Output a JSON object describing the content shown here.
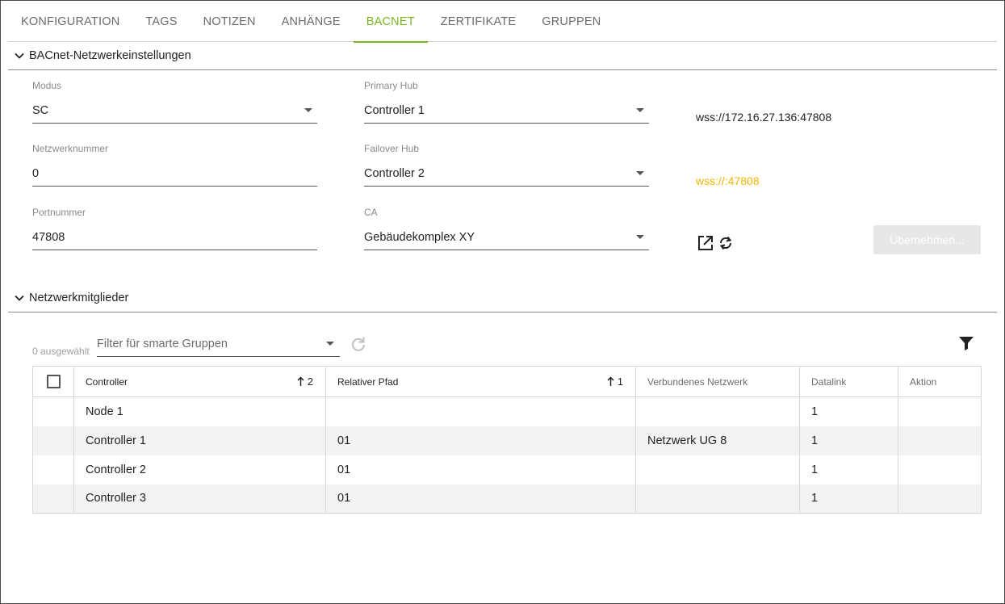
{
  "tabs": [
    {
      "label": "KONFIGURATION"
    },
    {
      "label": "TAGS"
    },
    {
      "label": "NOTIZEN"
    },
    {
      "label": "ANHÄNGE"
    },
    {
      "label": "BACNET",
      "active": true
    },
    {
      "label": "ZERTIFIKATE"
    },
    {
      "label": "GRUPPEN"
    }
  ],
  "network_settings": {
    "title": "BACnet-Netzwerkeinstellungen",
    "modus": {
      "label": "Modus",
      "value": "SC"
    },
    "netzwerknummer": {
      "label": "Netzwerknummer",
      "value": "0"
    },
    "portnummer": {
      "label": "Portnummer",
      "value": "47808"
    },
    "primary_hub": {
      "label": "Primary Hub",
      "value": "Controller 1"
    },
    "failover_hub": {
      "label": "Failover Hub",
      "value": "Controller 2"
    },
    "ca": {
      "label": "CA",
      "value": "Gebäudekomplex XY"
    },
    "primary_url": "wss://172.16.27.136:47808",
    "failover_url": "wss://:47808",
    "apply_label": "Übernehmen..."
  },
  "members": {
    "title": "Netzwerkmitglieder",
    "selected_count": "0 ausgewählt",
    "filter_placeholder": "Filter für smarte Gruppen",
    "columns": {
      "controller": "Controller",
      "controller_sort": "2",
      "path": "Relativer Pfad",
      "path_sort": "1",
      "network": "Verbundenes Netzwerk",
      "datalink": "Datalink",
      "action": "Aktion"
    },
    "rows": [
      {
        "controller": "Node 1",
        "path": "",
        "network": "",
        "datalink": "1",
        "action": ""
      },
      {
        "controller": "Controller 1",
        "path": "01",
        "network": "Netzwerk UG 8",
        "datalink": "1",
        "action": ""
      },
      {
        "controller": "Controller 2",
        "path": "01",
        "network": "",
        "datalink": "1",
        "action": ""
      },
      {
        "controller": "Controller 3",
        "path": "01",
        "network": "",
        "datalink": "1",
        "action": ""
      }
    ]
  },
  "colors": {
    "accent": "#7ab51d",
    "warning_url": "#f0b400"
  }
}
